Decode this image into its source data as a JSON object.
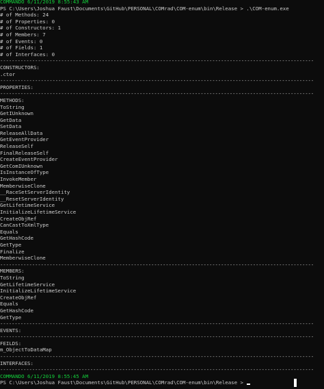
{
  "terminal": {
    "lines": [
      {
        "text": "COMMANDO 6/11/2019 8:55:43 AM",
        "kind": "green"
      },
      {
        "text": "PS C:\\Users\\Joshua Faust\\Documents\\GitHub\\PERSONAL\\COMrad\\COM-enum\\bin\\Release > .\\COM-enum.exe",
        "kind": "normal"
      },
      {
        "text": "# of Methods: 24",
        "kind": "normal"
      },
      {
        "text": "# of Properties: 0",
        "kind": "normal"
      },
      {
        "text": "# of Constructors: 1",
        "kind": "normal"
      },
      {
        "text": "# of Members: 7",
        "kind": "normal"
      },
      {
        "text": "# of Events: 0",
        "kind": "normal"
      },
      {
        "text": "# of Fields: 1",
        "kind": "normal"
      },
      {
        "text": "# of Interfaces: 0",
        "kind": "normal"
      },
      {
        "text": "------------------------------------------------------------------------------------------------------------",
        "kind": "sep"
      },
      {
        "text": "CONSTRUCTORS:",
        "kind": "normal"
      },
      {
        "text": ".ctor",
        "kind": "normal"
      },
      {
        "text": "------------------------------------------------------------------------------------------------------------",
        "kind": "sep"
      },
      {
        "text": "PROPERTIES:",
        "kind": "normal"
      },
      {
        "text": "------------------------------------------------------------------------------------------------------------",
        "kind": "sep"
      },
      {
        "text": "METHODS:",
        "kind": "normal"
      },
      {
        "text": "ToString",
        "kind": "normal"
      },
      {
        "text": "GetIUnknown",
        "kind": "normal"
      },
      {
        "text": "GetData",
        "kind": "normal"
      },
      {
        "text": "SetData",
        "kind": "normal"
      },
      {
        "text": "ReleaseAllData",
        "kind": "normal"
      },
      {
        "text": "GetEventProvider",
        "kind": "normal"
      },
      {
        "text": "ReleaseSelf",
        "kind": "normal"
      },
      {
        "text": "FinalReleaseSelf",
        "kind": "normal"
      },
      {
        "text": "CreateEventProvider",
        "kind": "normal"
      },
      {
        "text": "GetComIUnknown",
        "kind": "normal"
      },
      {
        "text": "IsInstanceOfType",
        "kind": "normal"
      },
      {
        "text": "InvokeMember",
        "kind": "normal"
      },
      {
        "text": "MemberwiseClone",
        "kind": "normal"
      },
      {
        "text": "__RaceSetServerIdentity",
        "kind": "normal"
      },
      {
        "text": "__ResetServerIdentity",
        "kind": "normal"
      },
      {
        "text": "GetLifetimeService",
        "kind": "normal"
      },
      {
        "text": "InitializeLifetimeService",
        "kind": "normal"
      },
      {
        "text": "CreateObjRef",
        "kind": "normal"
      },
      {
        "text": "CanCastToXmlType",
        "kind": "normal"
      },
      {
        "text": "Equals",
        "kind": "normal"
      },
      {
        "text": "GetHashCode",
        "kind": "normal"
      },
      {
        "text": "GetType",
        "kind": "normal"
      },
      {
        "text": "Finalize",
        "kind": "normal"
      },
      {
        "text": "MemberwiseClone",
        "kind": "normal"
      },
      {
        "text": "------------------------------------------------------------------------------------------------------------",
        "kind": "sep"
      },
      {
        "text": "MEMBERS:",
        "kind": "normal"
      },
      {
        "text": "ToString",
        "kind": "normal"
      },
      {
        "text": "GetLifetimeService",
        "kind": "normal"
      },
      {
        "text": "InitializeLifetimeService",
        "kind": "normal"
      },
      {
        "text": "CreateObjRef",
        "kind": "normal"
      },
      {
        "text": "Equals",
        "kind": "normal"
      },
      {
        "text": "GetHashCode",
        "kind": "normal"
      },
      {
        "text": "GetType",
        "kind": "normal"
      },
      {
        "text": "------------------------------------------------------------------------------------------------------------",
        "kind": "sep"
      },
      {
        "text": "EVENTS:",
        "kind": "normal"
      },
      {
        "text": "------------------------------------------------------------------------------------------------------------",
        "kind": "sep"
      },
      {
        "text": "FEILDS:",
        "kind": "normal"
      },
      {
        "text": "m_ObjectToDataMap",
        "kind": "normal"
      },
      {
        "text": "------------------------------------------------------------------------------------------------------------",
        "kind": "sep"
      },
      {
        "text": "INTERFACES:",
        "kind": "normal"
      },
      {
        "text": "------------------------------------------------------------------------------------------------------------",
        "kind": "sep"
      },
      {
        "text": "COMMANDO 6/11/2019 8:55:45 AM",
        "kind": "green"
      },
      {
        "text": "PS C:\\Users\\Joshua Faust\\Documents\\GitHub\\PERSONAL\\COMrad\\COM-enum\\bin\\Release >",
        "kind": "prompt"
      }
    ]
  },
  "colors": {
    "background": "#0c0c0c",
    "text": "#cccccc",
    "prompt_banner": "#13d13b",
    "cursor": "#ffffff"
  }
}
